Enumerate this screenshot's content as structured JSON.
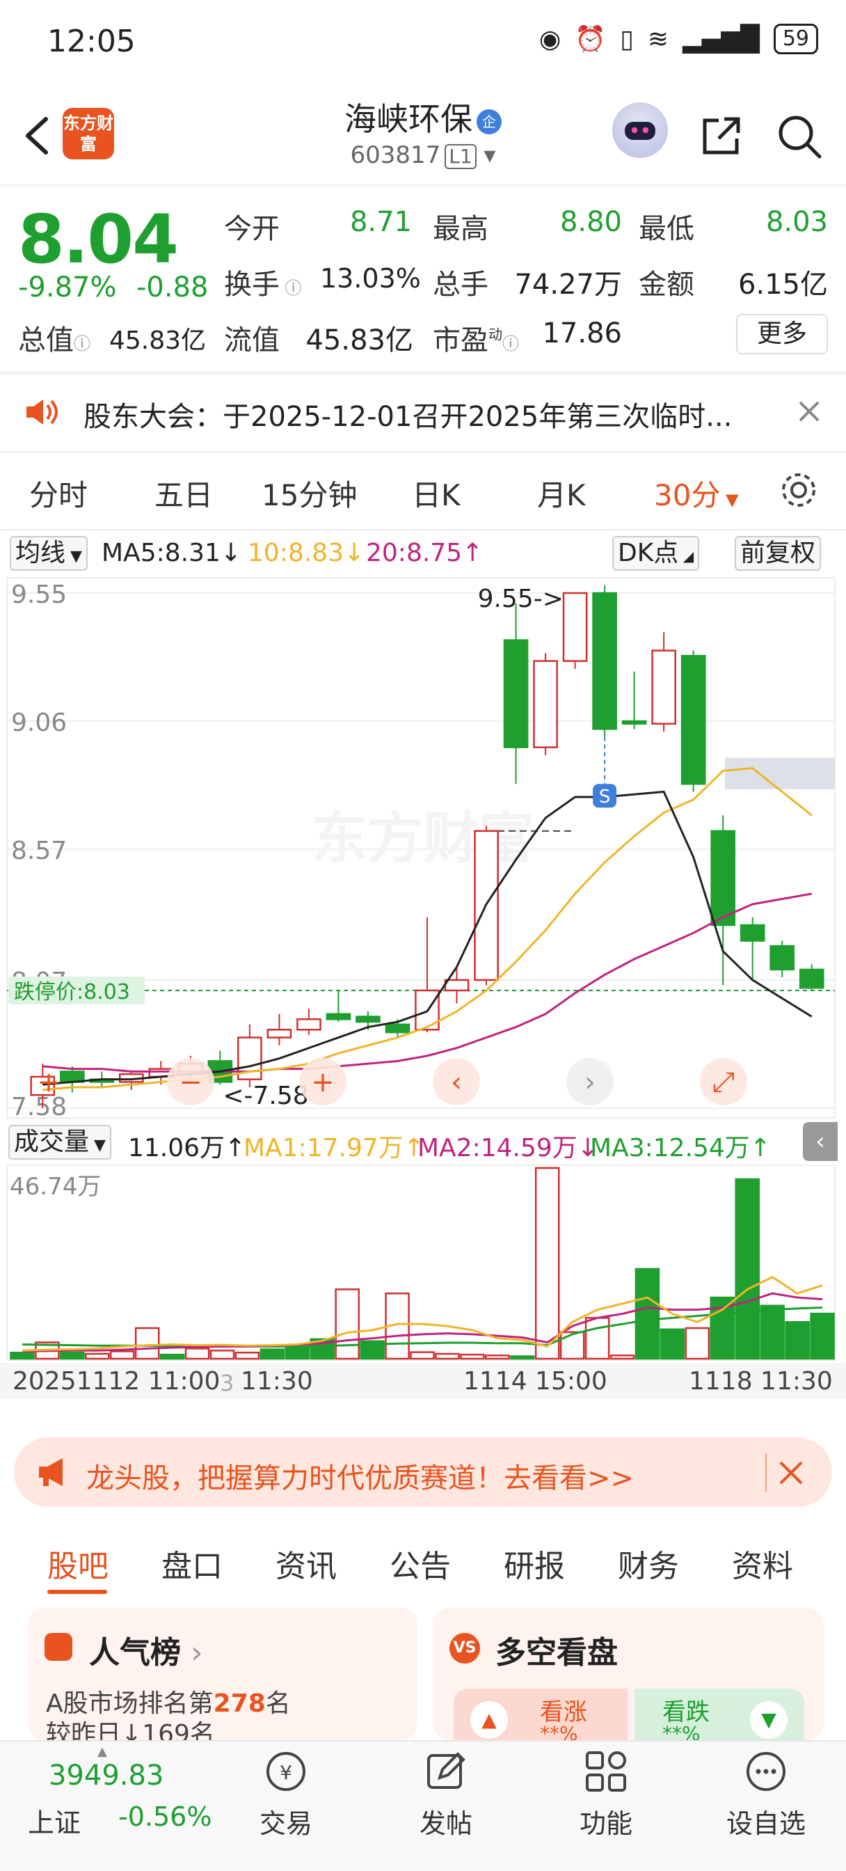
{
  "status_bar": {
    "time": "12:05",
    "battery": "59"
  },
  "header": {
    "app_logo_text": "东方财富",
    "stock_name": "海峡环保",
    "stock_badge": "企",
    "stock_code": "603817",
    "level_badge": "L1"
  },
  "quote": {
    "price": "8.04",
    "change_pct": "-9.87%",
    "change_abs": "-0.88",
    "open_label": "今开",
    "open": "8.71",
    "high_label": "最高",
    "high": "8.80",
    "low_label": "最低",
    "low": "8.03",
    "turnover_label": "换手",
    "turnover": "13.03%",
    "volume_label": "总手",
    "volume": "74.27万",
    "amount_label": "金额",
    "amount": "6.15亿",
    "mktcap_label": "总值",
    "mktcap": "45.83亿",
    "float_label": "流值",
    "float": "45.83亿",
    "pe_label": "市盈",
    "pe_sup": "动",
    "pe": "17.86",
    "more_label": "更多"
  },
  "notice": {
    "text": "股东大会：于2025-12-01召开2025年第三次临时..."
  },
  "kline_tabs": [
    "分时",
    "五日",
    "15分钟",
    "日K",
    "月K",
    "30分"
  ],
  "kline_active": "30分",
  "ma_bar": {
    "select_label": "均线",
    "ma5": "MA5:8.31↓",
    "ma10": "10:8.83↓",
    "ma20": "20:8.75↑",
    "dk_label": "DK点",
    "adjust_label": "前复权"
  },
  "kchart": {
    "y_ticks": [
      "9.55",
      "9.06",
      "8.57",
      "8.07",
      "7.58"
    ],
    "high_marker": "9.55->",
    "low_marker": "<-7.58",
    "limit_down_label": "跌停价:8.03",
    "watermark": "东方财富",
    "s_marker": "S"
  },
  "vol_bar": {
    "select_label": "成交量",
    "vol": "11.06万↑",
    "ma1": "MA1:17.97万↑",
    "ma2": "MA2:14.59万↓",
    "ma3": "MA3:12.54万↑"
  },
  "vchart": {
    "max_label": "46.74万"
  },
  "time_axis": {
    "left": "20251112 11:00",
    "mid0": "3",
    "mid1": "11:30",
    "mid2": "1114 15:00",
    "right": "1118 11:30"
  },
  "banner": {
    "text": "龙头股，把握算力时代优质赛道！去看看>>"
  },
  "sub_tabs": [
    "股吧",
    "盘口",
    "资讯",
    "公告",
    "研报",
    "财务",
    "资料"
  ],
  "sub_active": "股吧",
  "cards": {
    "popularity_title": "人气榜",
    "popularity_line1_pre": "A股市场排名第",
    "popularity_rank": "278",
    "popularity_line1_post": "名",
    "popularity_line2": "较昨日↓169名",
    "bullbear_title": "多空看盘",
    "bull_label": "看涨",
    "bull_pct": "**%",
    "bear_label": "看跌",
    "bear_pct": "**%"
  },
  "bottom_nav": {
    "index_value": "3949.83",
    "index_name": "上证",
    "index_change": "-0.56%",
    "items": [
      "交易",
      "发帖",
      "功能",
      "设自选"
    ]
  },
  "colors": {
    "down": "#1e9f2f",
    "up": "#d12e2e",
    "ma5": "#222222",
    "ma10": "#f0b429",
    "ma20": "#c0237e",
    "accent": "#e8531f"
  },
  "chart_data": [
    {
      "type": "candlestick",
      "title": "",
      "ylim": [
        7.58,
        9.55
      ],
      "y_ticks": [
        9.55,
        9.06,
        8.57,
        8.07,
        7.58
      ],
      "candles": [
        {
          "o": 7.63,
          "h": 7.75,
          "l": 7.58,
          "c": 7.7
        },
        {
          "o": 7.72,
          "h": 7.74,
          "l": 7.64,
          "c": 7.68
        },
        {
          "o": 7.69,
          "h": 7.72,
          "l": 7.66,
          "c": 7.68
        },
        {
          "o": 7.68,
          "h": 7.72,
          "l": 7.65,
          "c": 7.71
        },
        {
          "o": 7.7,
          "h": 7.76,
          "l": 7.67,
          "c": 7.73
        },
        {
          "o": 7.71,
          "h": 7.78,
          "l": 7.69,
          "c": 7.75
        },
        {
          "o": 7.76,
          "h": 7.8,
          "l": 7.67,
          "c": 7.68
        },
        {
          "o": 7.69,
          "h": 7.9,
          "l": 7.66,
          "c": 7.85
        },
        {
          "o": 7.85,
          "h": 7.94,
          "l": 7.82,
          "c": 7.88
        },
        {
          "o": 7.88,
          "h": 7.96,
          "l": 7.86,
          "c": 7.92
        },
        {
          "o": 7.94,
          "h": 8.03,
          "l": 7.91,
          "c": 7.92
        },
        {
          "o": 7.93,
          "h": 7.95,
          "l": 7.88,
          "c": 7.91
        },
        {
          "o": 7.9,
          "h": 7.92,
          "l": 7.85,
          "c": 7.87
        },
        {
          "o": 7.88,
          "h": 8.31,
          "l": 7.87,
          "c": 8.03
        },
        {
          "o": 8.03,
          "h": 8.12,
          "l": 7.98,
          "c": 8.07
        },
        {
          "o": 8.07,
          "h": 8.66,
          "l": 8.05,
          "c": 8.64
        },
        {
          "o": 9.37,
          "h": 9.51,
          "l": 8.82,
          "c": 8.96
        },
        {
          "o": 8.96,
          "h": 9.32,
          "l": 8.93,
          "c": 9.29
        },
        {
          "o": 9.29,
          "h": 9.55,
          "l": 9.26,
          "c": 9.55
        },
        {
          "o": 9.55,
          "h": 9.58,
          "l": 9.0,
          "c": 9.03
        },
        {
          "o": 9.06,
          "h": 9.25,
          "l": 9.03,
          "c": 9.05
        },
        {
          "o": 9.05,
          "h": 9.4,
          "l": 9.02,
          "c": 9.33
        },
        {
          "o": 9.31,
          "h": 9.33,
          "l": 8.79,
          "c": 8.82
        },
        {
          "o": 8.64,
          "h": 8.7,
          "l": 8.05,
          "c": 8.28
        },
        {
          "o": 8.28,
          "h": 8.31,
          "l": 8.07,
          "c": 8.22
        },
        {
          "o": 8.2,
          "h": 8.22,
          "l": 8.08,
          "c": 8.11
        },
        {
          "o": 8.11,
          "h": 8.13,
          "l": 8.03,
          "c": 8.04
        }
      ],
      "ma5": [
        7.67,
        7.68,
        7.69,
        7.69,
        7.7,
        7.71,
        7.72,
        7.74,
        7.77,
        7.81,
        7.85,
        7.89,
        7.91,
        7.95,
        8.12,
        8.36,
        8.53,
        8.69,
        8.77,
        8.77,
        8.78,
        8.79,
        8.54,
        8.18,
        8.07,
        8.0,
        7.93
      ],
      "ma10": [
        7.65,
        7.66,
        7.66,
        7.67,
        7.68,
        7.69,
        7.7,
        7.72,
        7.73,
        7.75,
        7.79,
        7.82,
        7.85,
        7.89,
        7.95,
        8.03,
        8.14,
        8.26,
        8.4,
        8.52,
        8.62,
        8.71,
        8.76,
        8.87,
        8.88,
        8.79,
        8.7
      ],
      "ma20": [
        7.74,
        7.73,
        7.73,
        7.72,
        7.72,
        7.72,
        7.72,
        7.72,
        7.73,
        7.73,
        7.74,
        7.75,
        7.76,
        7.78,
        7.81,
        7.85,
        7.89,
        7.94,
        8.02,
        8.09,
        8.15,
        8.2,
        8.25,
        8.31,
        8.36,
        8.38,
        8.4
      ],
      "limit_down": 8.03
    },
    {
      "type": "bar",
      "title": "",
      "ylim": [
        0,
        46.74
      ],
      "unit": "万",
      "volumes": [
        1.5,
        4.0,
        1.5,
        1.2,
        1.8,
        7.5,
        1.0,
        2.5,
        2.0,
        1.5,
        2.3,
        3.1,
        4.8,
        17.0,
        4.3,
        16.0,
        1.6,
        1.2,
        1.0,
        0.8,
        0.6,
        46.74,
        6.5,
        10.0,
        0.8,
        22.0,
        7.2,
        7.5,
        15.0,
        44.0,
        13.0,
        9.0,
        11.06
      ],
      "up": [
        false,
        true,
        false,
        true,
        true,
        true,
        false,
        true,
        true,
        true,
        false,
        false,
        false,
        true,
        false,
        true,
        true,
        true,
        true,
        true,
        false,
        true,
        true,
        true,
        true,
        false,
        false,
        true,
        false,
        false,
        false,
        false,
        false
      ],
      "ma1": [
        2.0,
        2.2,
        2.3,
        2.5,
        3.0,
        3.3,
        3.5,
        3.3,
        3.4,
        3.2,
        3.3,
        3.5,
        4.4,
        6.4,
        7.0,
        8.5,
        8.5,
        8.0,
        7.0,
        5.0,
        4.6,
        3.0,
        9.0,
        12.0,
        13.5,
        15.0,
        11.0,
        9.0,
        12.0,
        17.0,
        20.0,
        16.0,
        17.97
      ],
      "ma2": [
        1.8,
        1.9,
        2.0,
        2.0,
        2.2,
        2.5,
        2.7,
        2.9,
        3.0,
        3.0,
        3.2,
        3.4,
        3.8,
        4.5,
        5.0,
        5.6,
        6.0,
        6.2,
        6.0,
        5.6,
        5.2,
        4.0,
        8.0,
        10.0,
        11.0,
        12.5,
        12.0,
        12.0,
        12.5,
        14.0,
        16.0,
        15.0,
        14.59
      ],
      "ma3": [
        3.5,
        3.4,
        3.3,
        3.2,
        3.2,
        3.2,
        3.1,
        3.1,
        3.0,
        3.0,
        3.0,
        3.0,
        3.1,
        3.3,
        3.5,
        3.7,
        3.8,
        3.9,
        3.9,
        3.8,
        3.8,
        3.3,
        6.0,
        7.5,
        8.5,
        9.5,
        10.0,
        10.5,
        11.0,
        11.5,
        12.0,
        12.3,
        12.54
      ]
    }
  ]
}
